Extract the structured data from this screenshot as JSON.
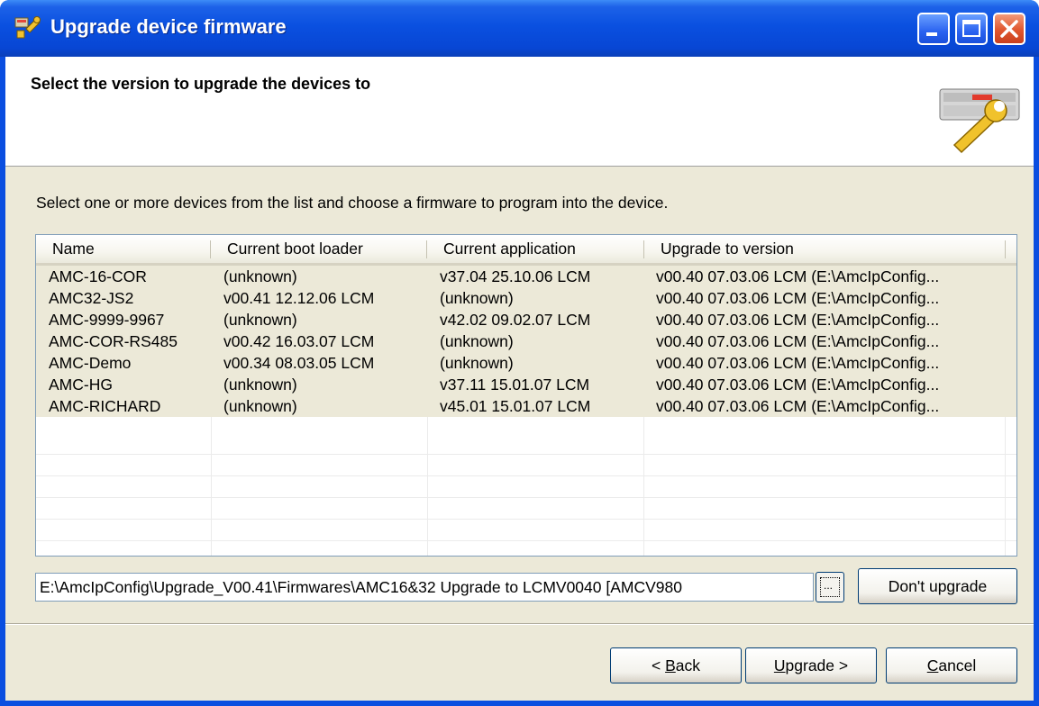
{
  "window": {
    "title": "Upgrade device firmware",
    "icon": "firmware-tool-icon"
  },
  "header": {
    "title": "Select the version to upgrade the devices to",
    "icon": "device-wrench-icon"
  },
  "instruction": "Select one or more devices from the list and choose a firmware to program into the device.",
  "list": {
    "columns": [
      "Name",
      "Current boot loader",
      "Current application",
      "Upgrade to version"
    ],
    "rows": [
      [
        "AMC-16-COR",
        "(unknown)",
        "v37.04 25.10.06  LCM",
        "v00.40 07.03.06  LCM (E:\\AmcIpConfig..."
      ],
      [
        "AMC32-JS2",
        "v00.41 12.12.06  LCM",
        "(unknown)",
        "v00.40 07.03.06  LCM (E:\\AmcIpConfig..."
      ],
      [
        "AMC-9999-9967",
        "(unknown)",
        "v42.02 09.02.07  LCM",
        "v00.40 07.03.06  LCM (E:\\AmcIpConfig..."
      ],
      [
        "AMC-COR-RS485",
        "v00.42 16.03.07  LCM",
        "(unknown)",
        "v00.40 07.03.06  LCM (E:\\AmcIpConfig..."
      ],
      [
        "AMC-Demo",
        "v00.34 08.03.05  LCM",
        "(unknown)",
        "v00.40 07.03.06  LCM (E:\\AmcIpConfig..."
      ],
      [
        "AMC-HG",
        "(unknown)",
        "v37.11 15.01.07  LCM",
        "v00.40 07.03.06  LCM (E:\\AmcIpConfig..."
      ],
      [
        "AMC-RICHARD",
        "(unknown)",
        "v45.01 15.01.07  LCM",
        "v00.40 07.03.06  LCM (E:\\AmcIpConfig..."
      ]
    ]
  },
  "firmware_path": "E:\\AmcIpConfig\\Upgrade_V00.41\\Firmwares\\AMC16&32 Upgrade to LCMV0040 [AMCV980",
  "buttons": {
    "browse_label": "...",
    "dont_upgrade": "Don't upgrade",
    "back_prefix": "< ",
    "back_mnemonic": "B",
    "back_rest": "ack",
    "upgrade_mnemonic": "U",
    "upgrade_rest": "pgrade >",
    "cancel_mnemonic": "C",
    "cancel_rest": "ancel"
  }
}
